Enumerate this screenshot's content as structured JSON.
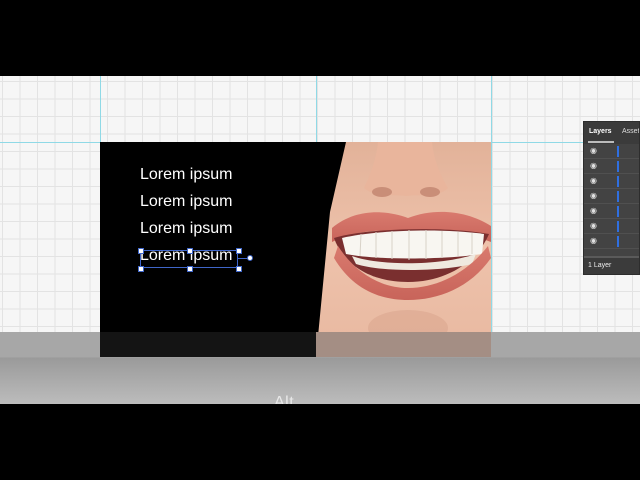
{
  "artboard": {
    "text_lines": [
      "Lorem ipsum",
      "Lorem ipsum",
      "Lorem ipsum",
      "Lorem ipsum"
    ],
    "selected_line_index": 3,
    "image_subject": "smiling-mouth-photo"
  },
  "layers_panel": {
    "tabs": [
      "Layers",
      "Asset"
    ],
    "active_tab": "Layers",
    "row_count": 7,
    "footer_label": "1 Layer",
    "accent_color": "#2f6fe0"
  },
  "overlay": {
    "caption": "Alt"
  },
  "colors": {
    "artboard_background": "#000000",
    "text": "#ffffff",
    "selection": "#3f66c9",
    "guide": "#8fd9e6"
  }
}
